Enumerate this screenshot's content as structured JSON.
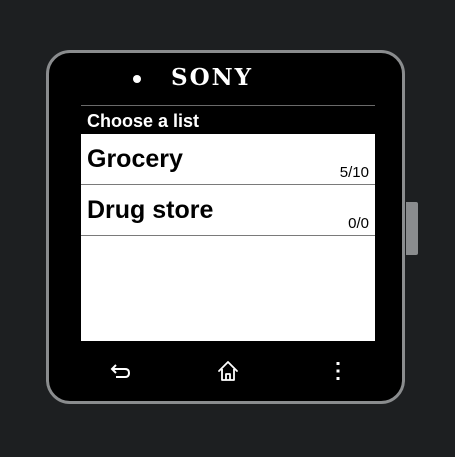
{
  "device": {
    "brand": "SONY"
  },
  "screen": {
    "header": "Choose a list",
    "lists": [
      {
        "name": "Grocery",
        "count": "5/10"
      },
      {
        "name": "Drug store",
        "count": "0/0"
      }
    ]
  },
  "nav": {
    "back_icon": "back-arrow-icon",
    "home_icon": "home-icon",
    "menu_icon": "overflow-menu-icon"
  },
  "colors": {
    "bezel": "#000000",
    "frame": "#8a8c8e",
    "background": "#1d1f21",
    "screen": "#ffffff",
    "text": "#000000"
  }
}
